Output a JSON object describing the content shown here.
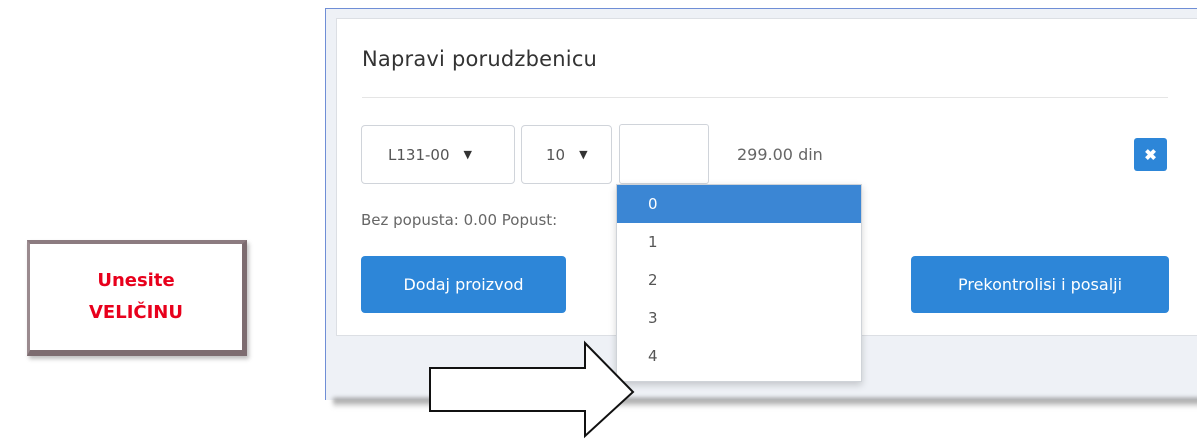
{
  "callout": {
    "line1": "Unesite",
    "line2": "VELIČINU"
  },
  "panel": {
    "title": "Napravi porudzbenicu",
    "product_select": "L131-00",
    "size_select": "10",
    "quantity_value": "",
    "price": "299.00 din",
    "remove_icon": "close-icon",
    "discount_text": "Bez popusta: 0.00 Popust:",
    "add_button": "Dodaj proizvod",
    "send_button": "Prekontrolisi i posalji"
  },
  "dropdown": {
    "options": [
      "0",
      "1",
      "2",
      "3",
      "4"
    ],
    "selected": "0"
  },
  "colors": {
    "accent": "#2d86d8",
    "callout_text": "#e8001c"
  }
}
